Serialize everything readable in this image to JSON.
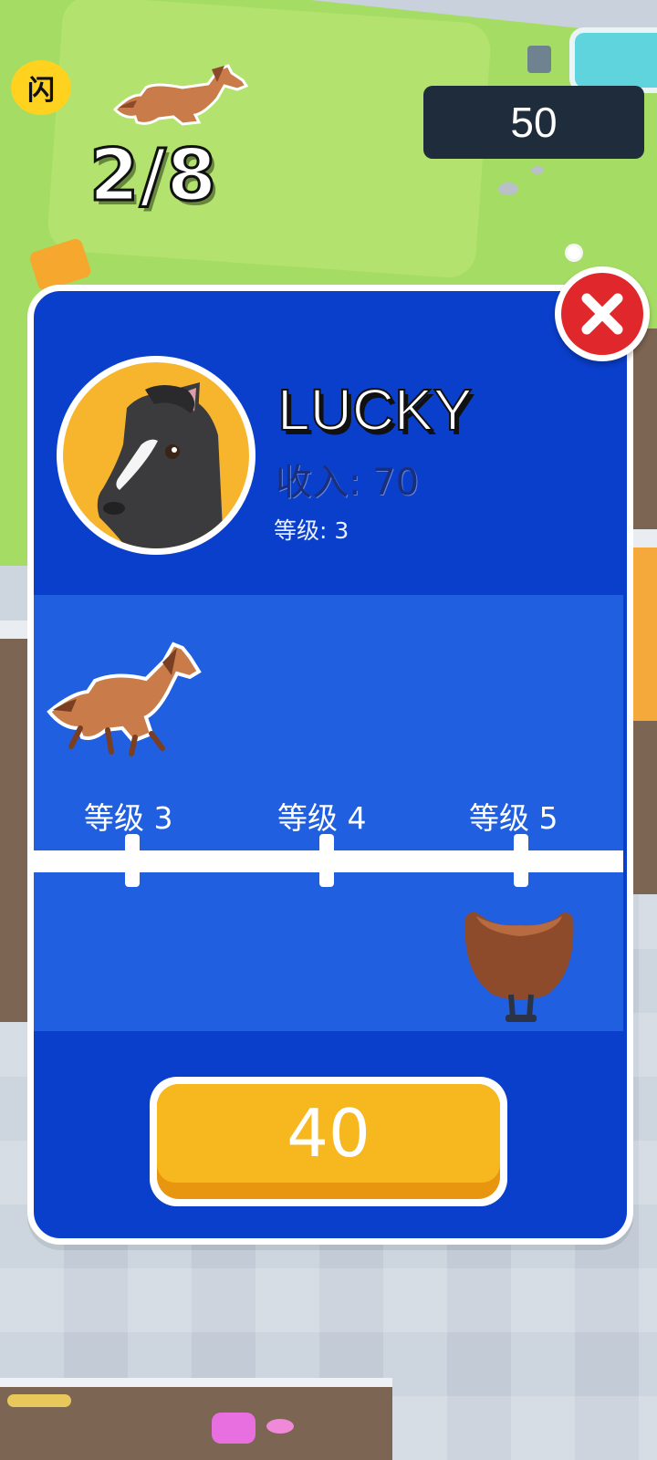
{
  "hud": {
    "badge_glyph": "闪",
    "progress": "2/8",
    "coins": "50"
  },
  "panel": {
    "name": "LUCKY",
    "income_label": "收入: 70",
    "level_label": "等级: 3",
    "track": {
      "levels": [
        "等级 3",
        "等级 4",
        "等级 5"
      ],
      "reward_icon": "saddle-icon",
      "current_icon": "horse-icon"
    },
    "buy_price": "40",
    "close_icon": "close-icon"
  },
  "colors": {
    "panel_bg": "#0a3fcc",
    "track_bg": "#1f5fe0",
    "buy_button": "#f6b81e",
    "close_button": "#e0282c",
    "avatar_bg": "#f7b52e",
    "grass": "#a5dc64"
  }
}
